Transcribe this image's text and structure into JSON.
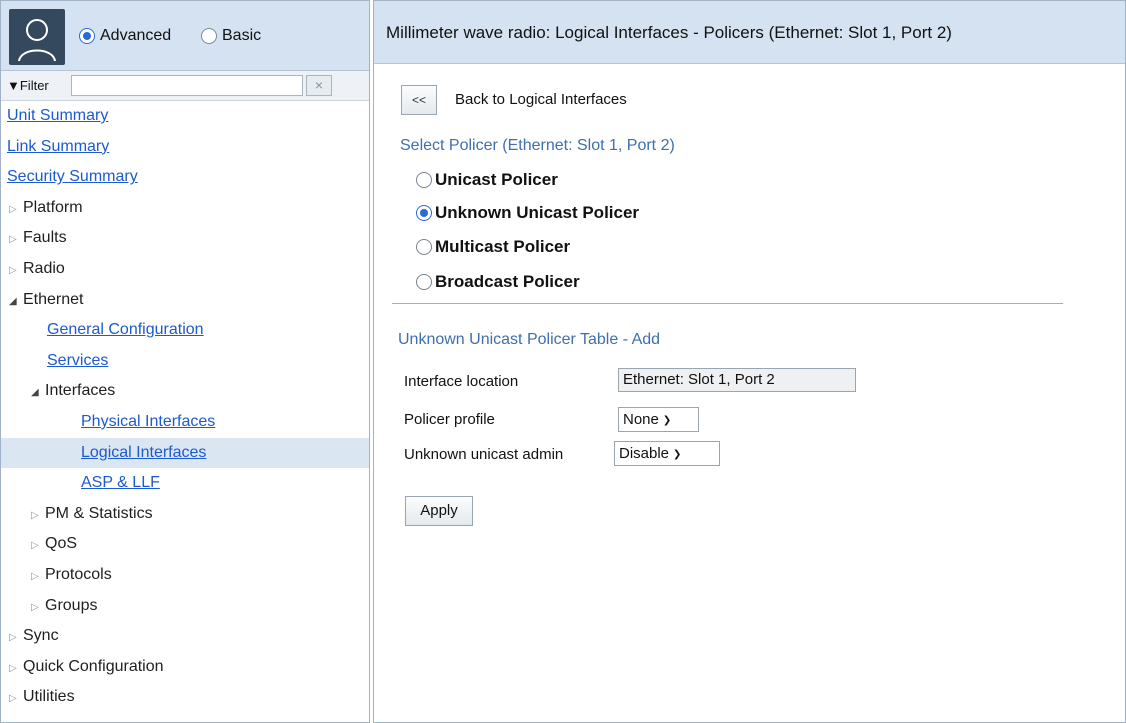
{
  "header": {
    "modes": [
      {
        "label": "Advanced",
        "checked": true
      },
      {
        "label": "Basic",
        "checked": false
      }
    ]
  },
  "filter": {
    "label": "▼Filter",
    "value": "",
    "clear": "×"
  },
  "nav": {
    "items": [
      {
        "label": "Unit Summary",
        "type": "link",
        "indent": 0
      },
      {
        "label": "Link Summary",
        "type": "link",
        "indent": 0
      },
      {
        "label": "Security Summary",
        "type": "link",
        "indent": 0
      },
      {
        "label": "Platform",
        "type": "collapsed",
        "indent": 0
      },
      {
        "label": "Faults",
        "type": "collapsed",
        "indent": 0
      },
      {
        "label": "Radio",
        "type": "collapsed",
        "indent": 0
      },
      {
        "label": "Ethernet",
        "type": "expanded",
        "indent": 0
      },
      {
        "label": "General Configuration",
        "type": "link",
        "indent": 1
      },
      {
        "label": "Services",
        "type": "link",
        "indent": 1
      },
      {
        "label": "Interfaces",
        "type": "expanded",
        "indent": 1
      },
      {
        "label": "Physical Interfaces",
        "type": "link",
        "indent": 2
      },
      {
        "label": "Logical Interfaces",
        "type": "link",
        "indent": 2,
        "selected": true
      },
      {
        "label": "ASP & LLF",
        "type": "link",
        "indent": 2
      },
      {
        "label": "PM & Statistics",
        "type": "collapsed",
        "indent": 1
      },
      {
        "label": "QoS",
        "type": "collapsed",
        "indent": 1
      },
      {
        "label": "Protocols",
        "type": "collapsed",
        "indent": 1
      },
      {
        "label": "Groups",
        "type": "collapsed",
        "indent": 1
      },
      {
        "label": "Sync",
        "type": "collapsed",
        "indent": 0
      },
      {
        "label": "Quick Configuration",
        "type": "collapsed",
        "indent": 0
      },
      {
        "label": "Utilities",
        "type": "collapsed",
        "indent": 0
      }
    ]
  },
  "main": {
    "title": "Millimeter wave radio: Logical Interfaces - Policers (Ethernet: Slot 1, Port 2)",
    "back_button": "<<",
    "back_label": "Back to Logical Interfaces",
    "select_heading": "Select Policer (Ethernet: Slot 1, Port 2)",
    "policers": [
      {
        "label": "Unicast Policer",
        "checked": false
      },
      {
        "label": "Unknown Unicast Policer",
        "checked": true
      },
      {
        "label": "Multicast Policer",
        "checked": false
      },
      {
        "label": "Broadcast Policer",
        "checked": false
      }
    ],
    "table_heading": "Unknown Unicast Policer Table - Add",
    "form": {
      "interface_location_label": "Interface location",
      "interface_location_value": "Ethernet: Slot 1, Port 2",
      "policer_profile_label": "Policer profile",
      "policer_profile_value": "None",
      "unknown_unicast_admin_label": "Unknown unicast admin",
      "unknown_unicast_admin_value": "Disable"
    },
    "apply_label": "Apply"
  },
  "colors": {
    "header_bg": "#d5e2f1",
    "link": "#1c5ad0",
    "heading": "#3f6fae",
    "radio_accent": "#2a6ad6",
    "selected_row": "#dbe6f3"
  }
}
